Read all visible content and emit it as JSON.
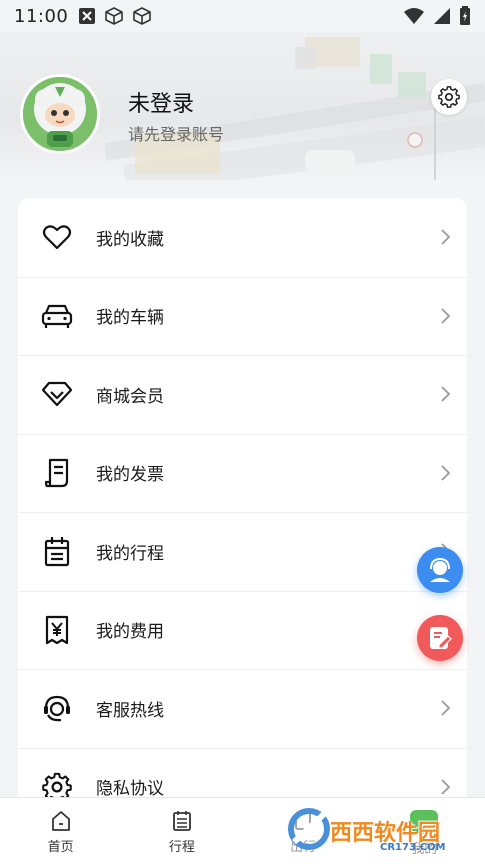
{
  "status_bar": {
    "time": "11:00",
    "left_icons": [
      "close-box-icon",
      "cube-icon",
      "cube-icon"
    ],
    "right_icons": [
      "wifi-icon",
      "signal-icon",
      "battery-icon"
    ]
  },
  "profile": {
    "name": "未登录",
    "subtitle": "请先登录账号"
  },
  "menu": {
    "items": [
      {
        "label": "我的收藏",
        "icon": "heart-icon"
      },
      {
        "label": "我的车辆",
        "icon": "car-icon"
      },
      {
        "label": "商城会员",
        "icon": "diamond-icon"
      },
      {
        "label": "我的发票",
        "icon": "invoice-icon"
      },
      {
        "label": "我的行程",
        "icon": "calendar-icon"
      },
      {
        "label": "我的费用",
        "icon": "receipt-yen-icon"
      },
      {
        "label": "客服热线",
        "icon": "headset-icon"
      },
      {
        "label": "隐私协议",
        "icon": "gear-icon"
      }
    ]
  },
  "tabbar": {
    "tabs": [
      {
        "label": "首页",
        "icon": "home-icon"
      },
      {
        "label": "行程",
        "icon": "list-icon"
      },
      {
        "label": "出行",
        "icon": "trip-icon"
      },
      {
        "label": "我的",
        "icon": "user-icon"
      }
    ]
  },
  "watermark": {
    "text": "西西软件园",
    "sub": "CR173.COM"
  },
  "colors": {
    "accent_blue": "#3d8cf0",
    "accent_red": "#f05a5a",
    "avatar_green": "#7bbf6a"
  }
}
